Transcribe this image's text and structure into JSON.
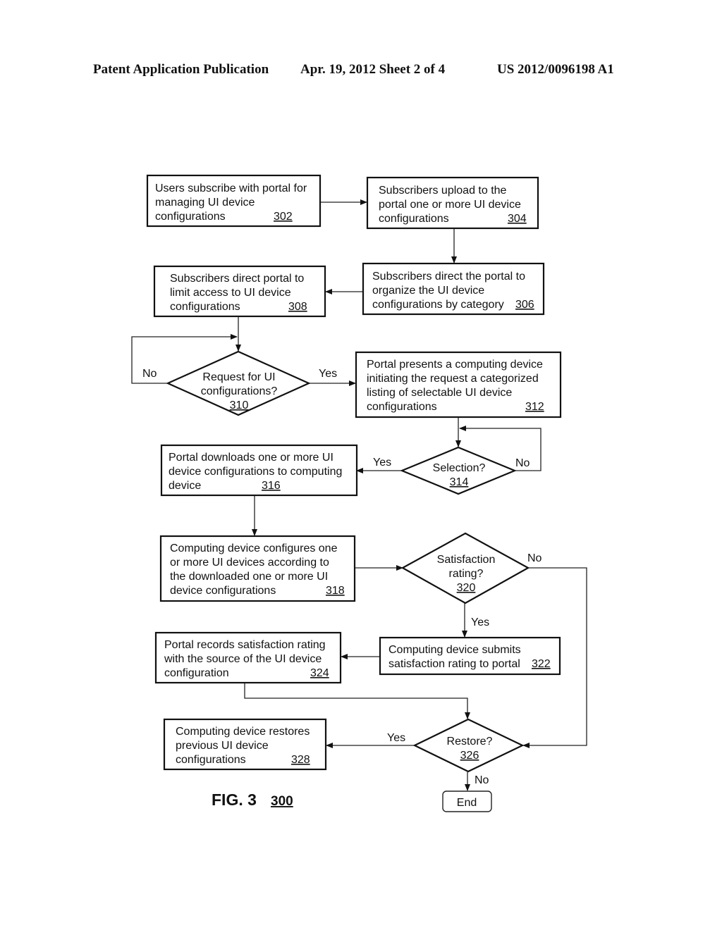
{
  "header": {
    "left": "Patent Application Publication",
    "middle": "Apr. 19, 2012  Sheet 2 of 4",
    "right": "US 2012/0096198 A1"
  },
  "figure": {
    "label": "FIG. 3",
    "ref": "300"
  },
  "steps": {
    "s302": {
      "lines": [
        "Users subscribe with portal for",
        "managing UI device",
        "configurations"
      ],
      "ref": "302"
    },
    "s304": {
      "lines": [
        "Subscribers upload to the",
        "portal one or more UI device",
        "configurations"
      ],
      "ref": "304"
    },
    "s306": {
      "lines": [
        "Subscribers direct the portal to",
        "organize the UI device",
        "configurations by category"
      ],
      "ref": "306"
    },
    "s308": {
      "lines": [
        "Subscribers direct portal to",
        "limit access to UI device",
        "configurations"
      ],
      "ref": "308"
    },
    "s310": {
      "lines": [
        "Request for UI",
        "configurations?"
      ],
      "ref": "310"
    },
    "s312": {
      "lines": [
        "Portal presents a computing device",
        "initiating the request a categorized",
        "listing of selectable UI device",
        "configurations"
      ],
      "ref": "312"
    },
    "s314": {
      "lines": [
        "Selection?"
      ],
      "ref": "314"
    },
    "s316": {
      "lines": [
        "Portal downloads one or more UI",
        "device configurations to computing",
        "device"
      ],
      "ref": "316"
    },
    "s318": {
      "lines": [
        "Computing device configures one",
        "or more UI devices according to",
        "the downloaded one or more UI",
        "device configurations"
      ],
      "ref": "318"
    },
    "s320": {
      "lines": [
        "Satisfaction",
        "rating?"
      ],
      "ref": "320"
    },
    "s322": {
      "lines": [
        "Computing device submits",
        "satisfaction rating to portal"
      ],
      "ref": "322"
    },
    "s324": {
      "lines": [
        "Portal records satisfaction rating",
        "with the source of the UI device",
        "configuration"
      ],
      "ref": "324"
    },
    "s326": {
      "lines": [
        "Restore?"
      ],
      "ref": "326"
    },
    "s328": {
      "lines": [
        "Computing device restores",
        "previous UI device",
        "configurations"
      ],
      "ref": "328"
    },
    "end": {
      "label": "End"
    }
  },
  "edge_labels": {
    "yes": "Yes",
    "no": "No"
  }
}
